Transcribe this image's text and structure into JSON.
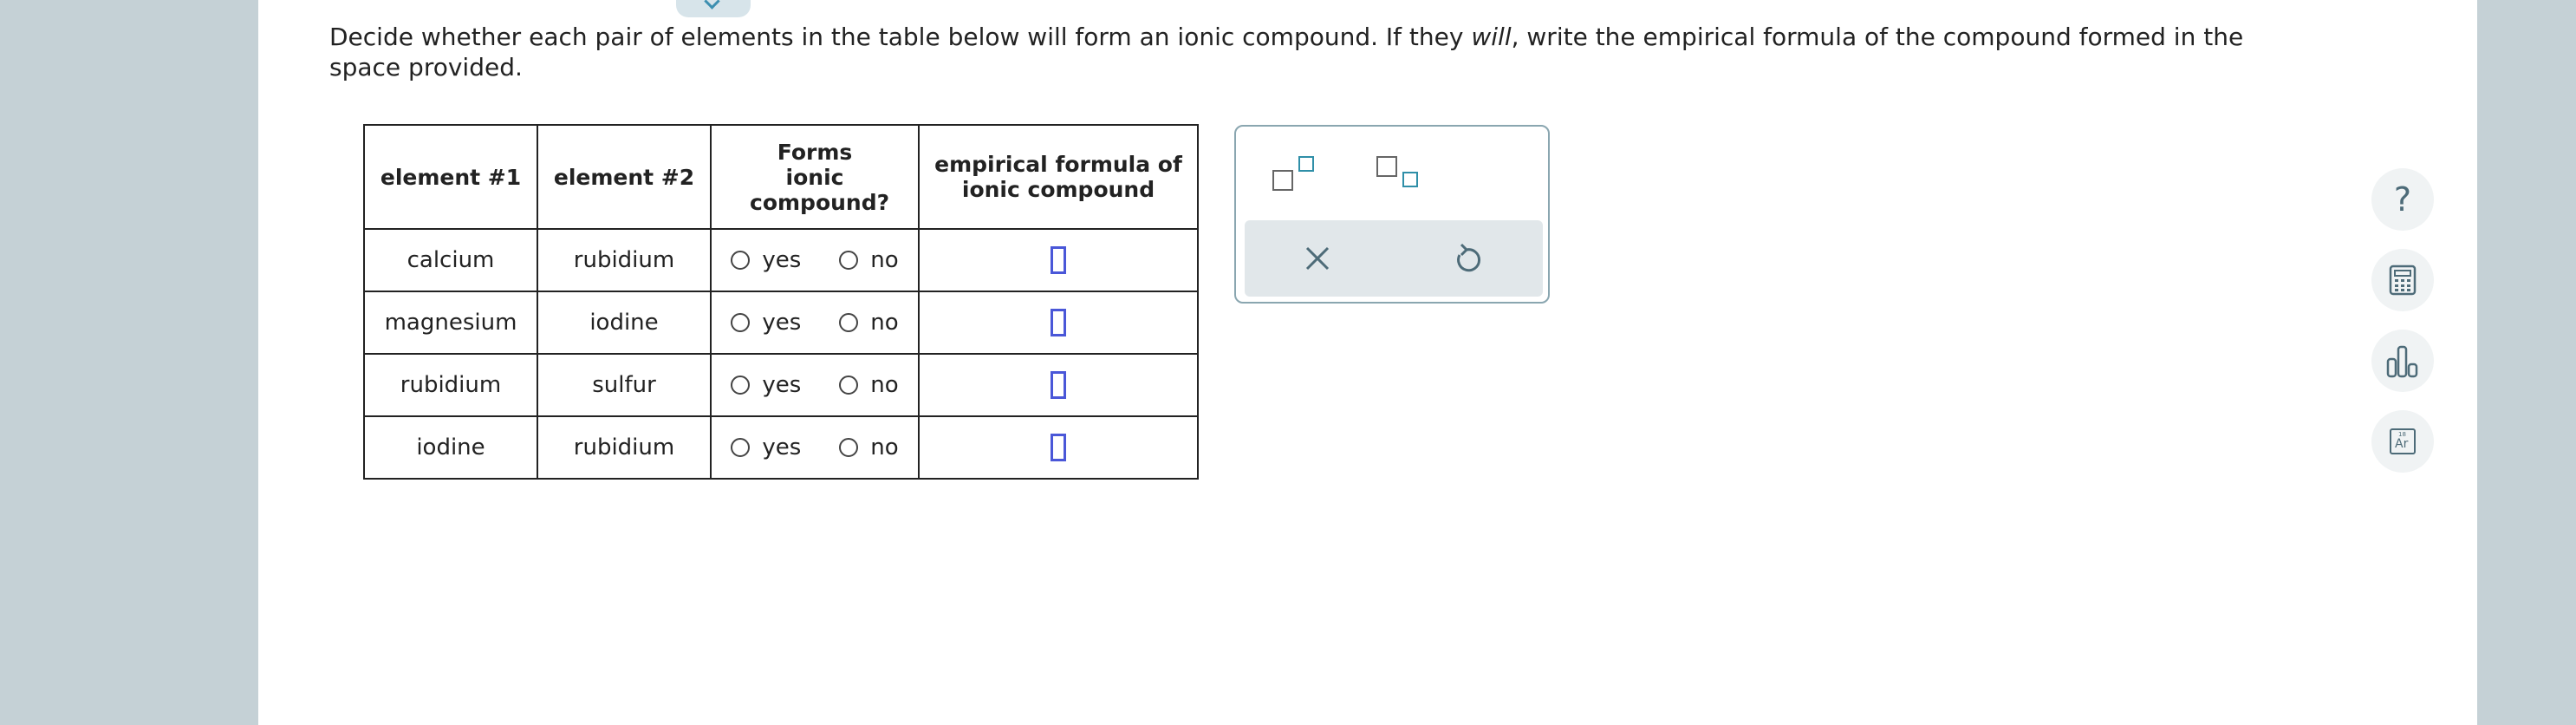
{
  "question": {
    "text_before": "Decide whether each pair of elements in the table below will form an ionic compound. If they ",
    "emphasis": "will",
    "text_after": ", write the empirical formula of the compound formed in the space provided."
  },
  "table": {
    "headers": [
      "element #1",
      "element #2",
      "Forms ionic compound?",
      "empirical formula of ionic compound"
    ],
    "rows": [
      {
        "element1": "calcium",
        "element2": "rubidium",
        "yes_label": "yes",
        "no_label": "no"
      },
      {
        "element1": "magnesium",
        "element2": "iodine",
        "yes_label": "yes",
        "no_label": "no"
      },
      {
        "element1": "rubidium",
        "element2": "sulfur",
        "yes_label": "yes",
        "no_label": "no"
      },
      {
        "element1": "iodine",
        "element2": "rubidium",
        "yes_label": "yes",
        "no_label": "no"
      }
    ]
  },
  "palette": {
    "buttons": [
      "superscript-icon",
      "subscript-icon",
      "clear-icon",
      "undo-icon"
    ]
  },
  "side_tools": {
    "help_label": "?",
    "icons": [
      "help-icon",
      "calculator-icon",
      "bar-chart-icon",
      "periodic-table-icon"
    ],
    "periodic_symbol": "Ar",
    "periodic_number": "18"
  },
  "colors": {
    "background": "#c5d1d6",
    "answer_box": "#4a57d8",
    "accent": "#2f8fa8"
  }
}
